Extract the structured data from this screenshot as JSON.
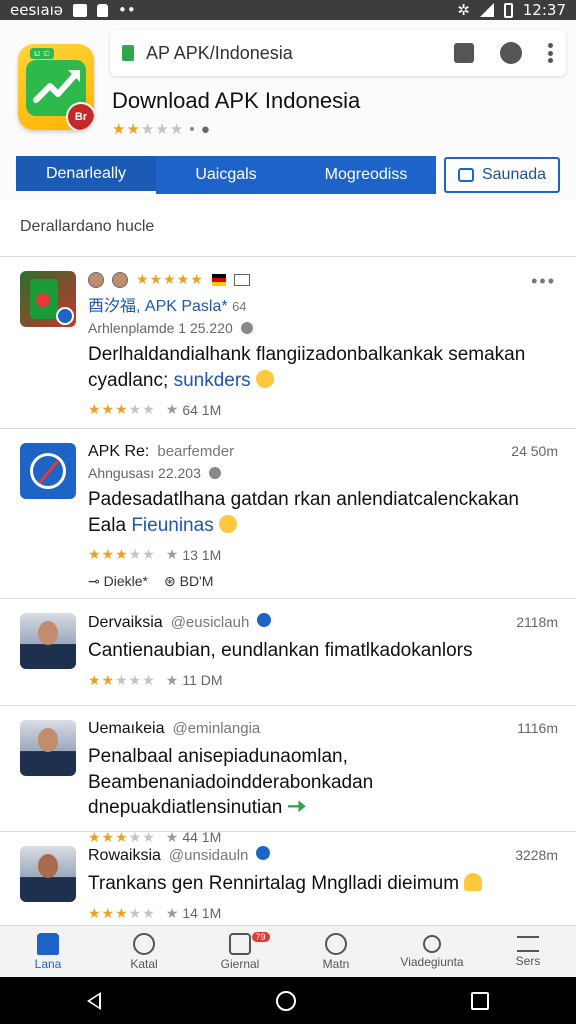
{
  "status_bar": {
    "left_text": "eesıaıə",
    "time": "12:37"
  },
  "browser": {
    "url": "AP APK/Indonesia"
  },
  "app": {
    "icon_tag": "ಟ ಐ",
    "badge": "Br",
    "title": "Download APK Indonesia",
    "rating": 2.5
  },
  "tabs": [
    {
      "label": "Denarleally",
      "active": true
    },
    {
      "label": "Uaicgals",
      "active": false
    },
    {
      "label": "Mogreodiss",
      "active": false
    }
  ],
  "save_button": {
    "label": "Saunada"
  },
  "section_label": "Derallardano hucle",
  "posts": [
    {
      "name": "",
      "handle": "",
      "time": "",
      "blue_name": "酉汐福, APK Pasla*",
      "blue_suffix": "64",
      "meta": "Arhlenplamde 1 25.220",
      "text": "Derlhaldandialhank flangiizadonbalkankak semakan cyadlanc;",
      "link": "sunkders",
      "rating_count": "64 1M",
      "more": "•••"
    },
    {
      "name": "APK Re:",
      "handle": "bearfemder",
      "time": "24 50m",
      "meta": "Ahngusası 22.203",
      "text": "Padesadatlhana gatdan rkan anlendiatcalenckakan Eala",
      "link": "Fieuninas",
      "rating_count": "13 1M",
      "extra_left": "Diekle*",
      "extra_right": "BD'M"
    },
    {
      "name": "Dervaiksia",
      "handle": "@eusiclauh",
      "time": "2118m",
      "text": "Cantienaubian, eundlankan fimatlkadokanlors",
      "rating_count": "11 DM"
    },
    {
      "name": "Uemaıkeia",
      "handle": "@eminlangia",
      "time": "1116m",
      "text": "Penalbaal anisepiadunaomlan, Beambenaniadoindderabonkadan dnepuakdiatlensinutian",
      "rating_count": "44 1M"
    },
    {
      "name": "Rowaiksia",
      "handle": "@unsidauln",
      "time": "3228m",
      "text": "Trankans gen Rennirtalag Mnglladi dieimum",
      "rating_count": "14 1M"
    }
  ],
  "bottom_nav": [
    {
      "label": "Lana",
      "active": true
    },
    {
      "label": "Katal",
      "active": false
    },
    {
      "label": "Giernal",
      "active": false,
      "badge": "79"
    },
    {
      "label": "Matn",
      "active": false
    },
    {
      "label": "Viadegiunta",
      "active": false
    },
    {
      "label": "Sers",
      "active": false
    }
  ],
  "icons": {
    "status": [
      "image-icon",
      "android-icon",
      "dots-icon",
      "mute-icon",
      "signal-icon",
      "battery-icon"
    ],
    "browser": [
      "lock-icon",
      "tabs-icon",
      "profile-icon",
      "menu-icon"
    ]
  },
  "colors": {
    "accent": "#1e64c8",
    "star": "#f0a020",
    "brand_green": "#2fb84c"
  }
}
